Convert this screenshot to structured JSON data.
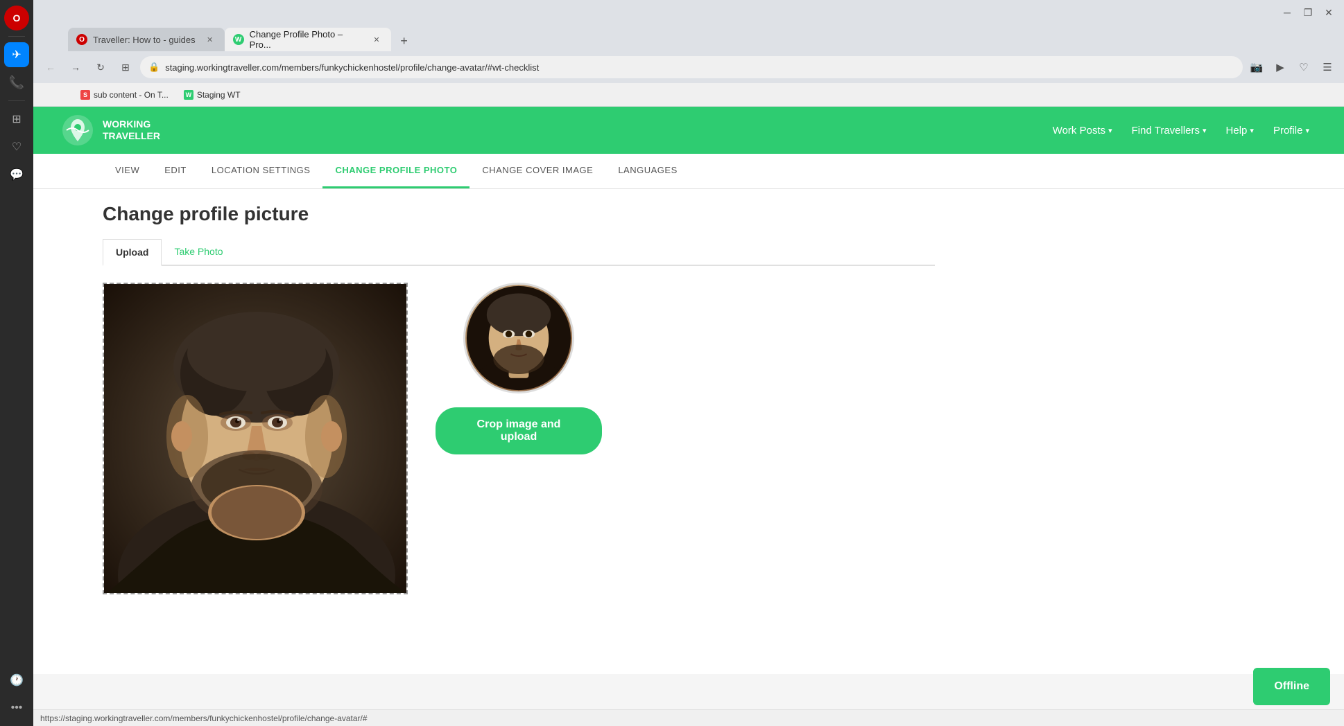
{
  "browser": {
    "tabs": [
      {
        "id": "tab1",
        "title": "Traveller: How to - guides",
        "favicon": "O",
        "active": false
      },
      {
        "id": "tab2",
        "title": "Change Profile Photo – Pro...",
        "favicon": "W",
        "active": true
      }
    ],
    "url": "staging.workingtraveller.com/members/funkychickenhostel/profile/change-avatar/#wt-checklist",
    "bookmarks": [
      {
        "label": "sub content - On T...",
        "favicon": "S"
      },
      {
        "label": "Staging WT",
        "favicon": "W"
      }
    ]
  },
  "sidebar": {
    "icons": [
      {
        "name": "opera-logo",
        "symbol": "O",
        "label": "Opera"
      },
      {
        "name": "messenger-icon",
        "symbol": "✈",
        "label": "Messenger"
      },
      {
        "name": "whatsapp-icon",
        "symbol": "📱",
        "label": "WhatsApp"
      },
      {
        "name": "sidebar-divider",
        "symbol": "",
        "label": ""
      },
      {
        "name": "dashboard-icon",
        "symbol": "⊞",
        "label": "Dashboard"
      },
      {
        "name": "heart-icon",
        "symbol": "♡",
        "label": "Favorites"
      },
      {
        "name": "chat-icon",
        "symbol": "💬",
        "label": "Chat"
      },
      {
        "name": "history-icon",
        "symbol": "🕐",
        "label": "History"
      }
    ]
  },
  "site_header": {
    "logo_text_line1": "WORKING",
    "logo_text_line2": "TRAVELLER",
    "nav_items": [
      {
        "label": "Work Posts",
        "has_dropdown": true
      },
      {
        "label": "Find Travellers",
        "has_dropdown": true
      },
      {
        "label": "Help",
        "has_dropdown": true
      },
      {
        "label": "Profile",
        "has_dropdown": true
      }
    ]
  },
  "sub_nav": {
    "items": [
      {
        "label": "VIEW",
        "active": false
      },
      {
        "label": "EDIT",
        "active": false
      },
      {
        "label": "LOCATION SETTINGS",
        "active": false
      },
      {
        "label": "CHANGE PROFILE PHOTO",
        "active": true
      },
      {
        "label": "CHANGE COVER IMAGE",
        "active": false
      },
      {
        "label": "LANGUAGES",
        "active": false
      }
    ]
  },
  "page": {
    "title": "Change profile picture",
    "upload_tab": "Upload",
    "take_photo_tab": "Take Photo",
    "crop_button_label": "Crop image and upload",
    "offline_label": "Offline"
  },
  "status_bar": {
    "url": "https://staging.workingtraveller.com/members/funkychickenhostel/profile/change-avatar/#"
  }
}
